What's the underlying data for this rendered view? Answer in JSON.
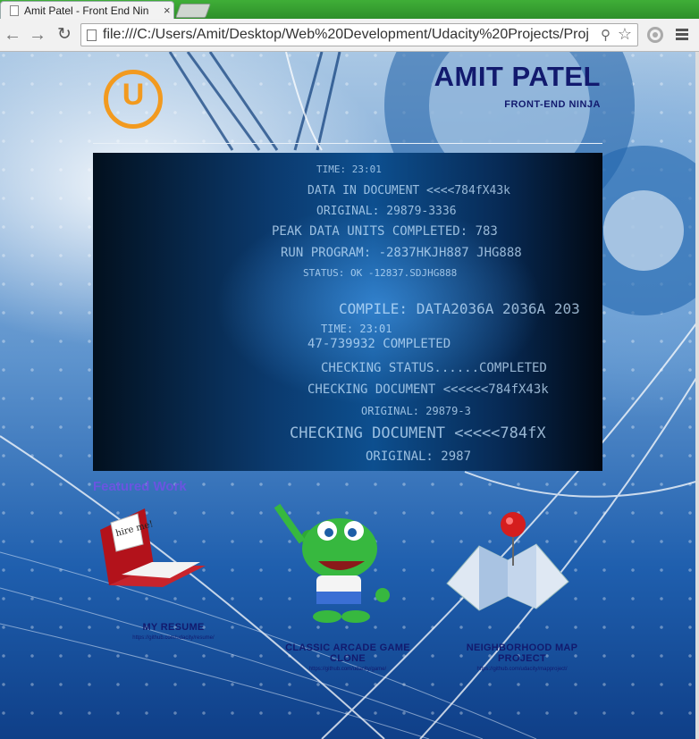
{
  "browser": {
    "tab_title": "Amit Patel - Front End Nin",
    "tab_close": "×",
    "url": "file:///C:/Users/Amit/Desktop/Web%20Development/Udacity%20Projects/Proj",
    "back_icon": "arrow-left-icon",
    "forward_icon": "arrow-right-icon",
    "reload_icon": "reload-icon",
    "zoom_icon": "magnifier-icon",
    "bookmark_icon": "star-icon"
  },
  "header": {
    "logo_letter": "U",
    "title": "AMIT PATEL",
    "subtitle": "FRONT-END NINJA"
  },
  "hero": {
    "lines": [
      "TIME: 23:01",
      "DATA IN DOCUMENT <<<<784fX43k",
      "ORIGINAL: 29879-3336",
      "PEAK DATA UNITS COMPLETED: 783",
      "RUN PROGRAM: -2837HKJH887 JHG888",
      "STATUS: OK -12837.SDJHG888",
      "COMPILE: DATA2036A 2036A 203",
      "TIME: 23:01",
      "47-739932 COMPLETED",
      "CHECKING STATUS......COMPLETED",
      "CHECKING DOCUMENT <<<<<<784fX43k",
      "ORIGINAL: 29879-3",
      "CHECKING DOCUMENT <<<<<784fX",
      "ORIGINAL: 2987"
    ]
  },
  "featured": {
    "heading": "Featured Work",
    "projects": [
      {
        "name": "MY RESUME",
        "link": "https://github.com/udacity/resume/",
        "note_text": "hire me!"
      },
      {
        "name": "CLASSIC ARCADE GAME CLONE",
        "link": "https://github.com/udacity/game/"
      },
      {
        "name": "NEIGHBORHOOD MAP PROJECT",
        "link": "https://github.com/udacity/mapproject/"
      }
    ]
  },
  "colors": {
    "tabstrip": "#3fae37",
    "title_text": "#121a6e",
    "featured_heading": "#6a55e0",
    "logo_orange": "#f29a1f"
  }
}
